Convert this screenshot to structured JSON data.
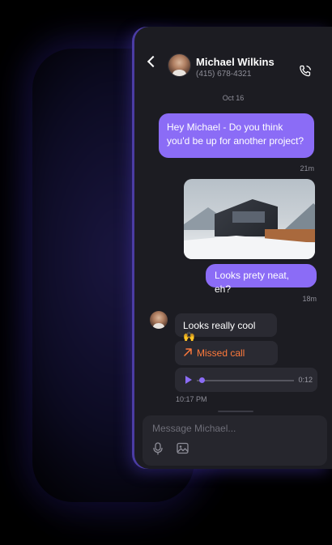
{
  "contact": {
    "name": "Michael Wilkins",
    "phone": "(415) 678-4321"
  },
  "chat": {
    "date_separator": "Oct 16",
    "messages": [
      {
        "from": "me",
        "text": "Hey Michael - Do you think you'd be up for another project?",
        "time": "21m"
      },
      {
        "from": "me",
        "type": "image",
        "image_icon": "photo-of-snowy-house"
      },
      {
        "from": "me",
        "text": "Looks prety neat, eh?",
        "time": "18m"
      },
      {
        "from": "them",
        "text": "Looks really cool 🙌"
      },
      {
        "from": "them",
        "type": "missed-call",
        "text": "Missed call"
      },
      {
        "from": "them",
        "type": "voice",
        "duration": "0:12",
        "progress": 0.05,
        "time": "10:17 PM"
      }
    ]
  },
  "composer": {
    "placeholder": "Message Michael..."
  },
  "colors": {
    "accent": "#8b6cf6",
    "missed_call": "#ff7a3c",
    "background": "#1c1c22"
  }
}
